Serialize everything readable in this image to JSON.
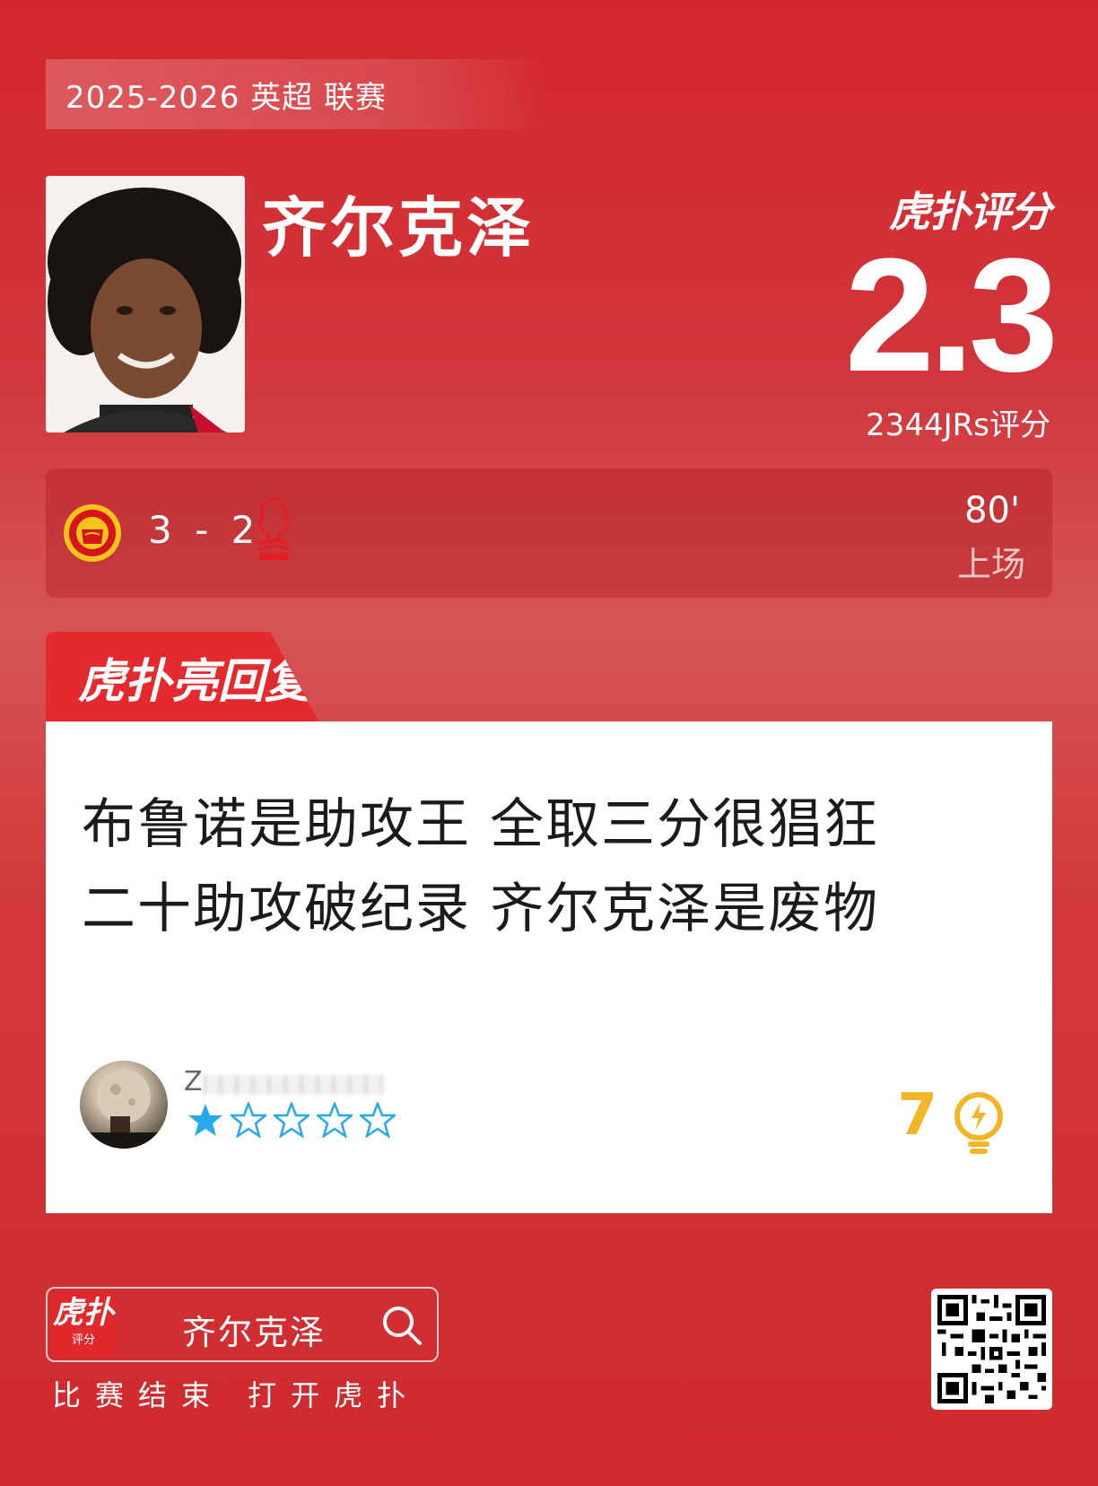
{
  "header": {
    "league": "2025-2026 英超 联赛"
  },
  "player": {
    "name": "齐尔克泽"
  },
  "rating": {
    "brand": "虎扑评分",
    "score": "2.3",
    "count_label": "2344JRs评分"
  },
  "match": {
    "score": "3 - 2",
    "home_team_icon": "manchester-united-crest",
    "away_team_icon": "nottingham-forest-crest",
    "minutes": "80'",
    "status": "上场"
  },
  "reply": {
    "tab_label": "虎扑亮回复",
    "comment_lines": [
      "布鲁诺是助攻王 全取三分很猖狂",
      "二十助攻破纪录 齐尔克泽是废物"
    ],
    "username": "Z",
    "stars": 1,
    "max_stars": 5,
    "likes": "7"
  },
  "footer": {
    "app_logo_main": "虎扑",
    "app_logo_sub": "评分",
    "search_text": "齐尔克泽",
    "caption": "比赛结束  打开虎扑"
  },
  "colors": {
    "brand_red": "#d4272d",
    "star_blue": "#29a9ea",
    "like_yellow": "#f3b529"
  }
}
